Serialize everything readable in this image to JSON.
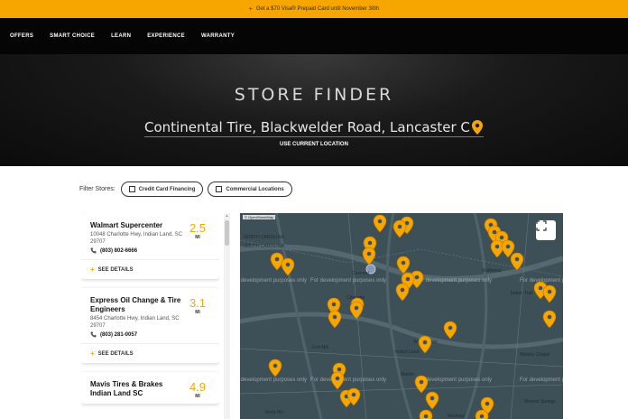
{
  "promo": {
    "text": "Get a $70 Visa® Prepaid Card until November 30th"
  },
  "nav": {
    "items": [
      "OFFERS",
      "SMART CHOICE",
      "LEARN",
      "EXPERIENCE",
      "WARRANTY"
    ]
  },
  "hero": {
    "title": "STORE FINDER",
    "search_value": "Continental Tire, Blackwelder Road, Lancaster County",
    "use_location": "USE CURRENT LOCATION"
  },
  "filters": {
    "label": "Filter Stores:",
    "options": [
      "Credit Card Financing",
      "Commercial Locations"
    ]
  },
  "stores": [
    {
      "name": "Walmart Supercenter",
      "address": "10048 Charlotte Hwy, Indian Land, SC 29707",
      "phone": "(803) 802-6666",
      "distance": "2.5",
      "unit": "MI",
      "details": "SEE DETAILS"
    },
    {
      "name": "Express Oil Change & Tire Engineers",
      "address": "8454 Charlotte Hwy, Indian Land, SC 29707",
      "phone": "(803) 281-0057",
      "distance": "3.1",
      "unit": "MI",
      "details": "SEE DETAILS"
    },
    {
      "name": "Mavis Tires & Brakes Indian Land SC",
      "address": "",
      "phone": "",
      "distance": "4.9",
      "unit": "MI",
      "details": "SEE DETAILS"
    }
  ],
  "map": {
    "attribution": "© OpenStreetMap",
    "watermark": "For development purposes only",
    "pin_color": "#f7a600",
    "region_labels": [
      "NORTH CAROLINA",
      "SOUTH CAROLINA",
      "Concord",
      "Charlotte",
      "Matthews",
      "Indian Land",
      "Waxhaw",
      "Weddington",
      "Wesley Chapel",
      "Rock Hill",
      "Fort Mill",
      "Mineral Springs",
      "Indian Trail",
      "Marvin"
    ]
  },
  "colors": {
    "accent": "#f7a600",
    "nav_bg": "#050505"
  }
}
